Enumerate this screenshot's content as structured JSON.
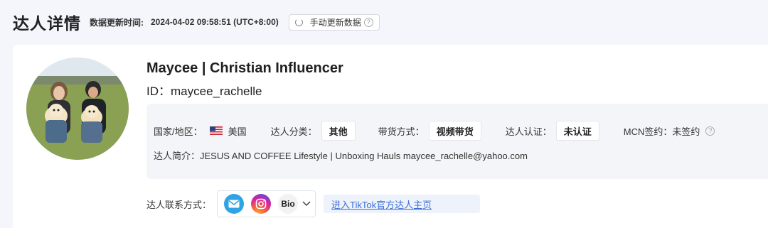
{
  "header": {
    "title": "达人详情",
    "update_label": "数据更新时间:",
    "update_time": "2024-04-02 09:58:51 (UTC+8:00)",
    "refresh_button": "手动更新数据"
  },
  "profile": {
    "name": "Maycee | Christian Influencer",
    "id_text": "ID：maycee_rachelle"
  },
  "info": {
    "country_label": "国家/地区：",
    "country_value": "美国",
    "category_label": "达人分类：",
    "category_value": "其他",
    "sales_label": "带货方式：",
    "sales_value": "视频带货",
    "cert_label": "达人认证：",
    "cert_value": "未认证",
    "mcn_label": "MCN签约：",
    "mcn_value": "未签约",
    "bio_label": "达人简介：",
    "bio_value": "JESUS AND COFFEE Lifestyle | Unboxing Hauls maycee_rachelle@yahoo.com"
  },
  "contact": {
    "label": "达人联系方式：",
    "bio_badge": "Bio",
    "icons": [
      "mail-icon",
      "instagram-icon"
    ]
  },
  "tiktok_link": "进入TikTok官方达人主页"
}
